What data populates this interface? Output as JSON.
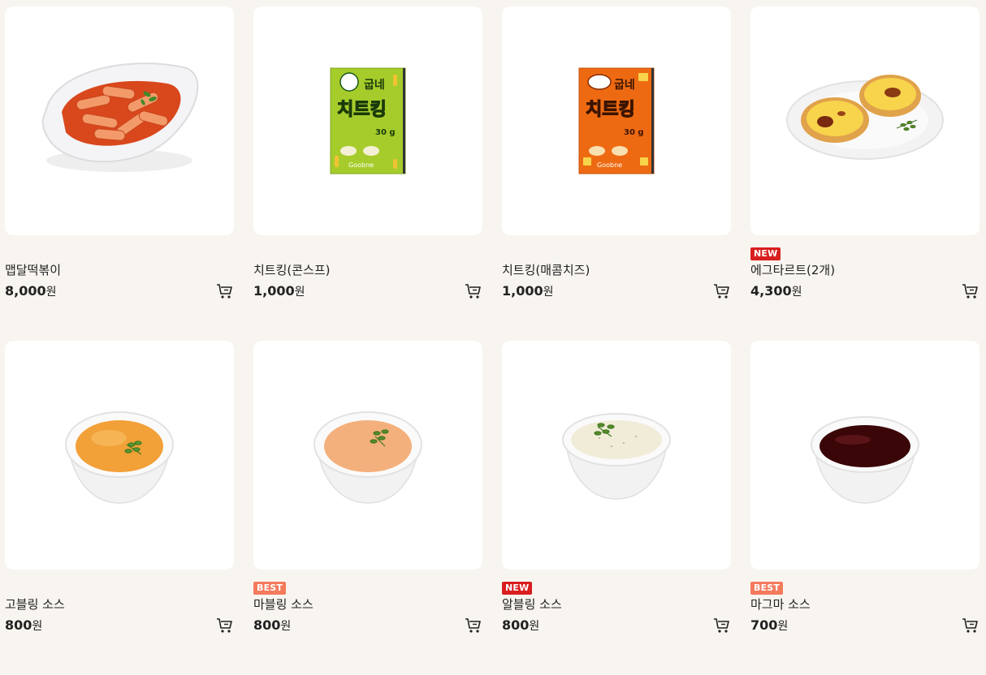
{
  "products": [
    {
      "name": "맵달떡볶이",
      "price": "8,000",
      "currency": "원",
      "badge": "",
      "image": "tteokbokki-image"
    },
    {
      "name": "치트킹(콘스프)",
      "price": "1,000",
      "currency": "원",
      "badge": "",
      "image": "cheatking-cornsoup-image",
      "pack_text": {
        "brand": "굽네",
        "title": "치트킹",
        "weight": "30 g",
        "logo": "Goobne"
      }
    },
    {
      "name": "치트킹(매콤치즈)",
      "price": "1,000",
      "currency": "원",
      "badge": "",
      "image": "cheatking-spicycheese-image",
      "pack_text": {
        "brand": "굽네",
        "title": "치트킹",
        "weight": "30 g",
        "logo": "Goobne"
      }
    },
    {
      "name": "에그타르트(2개)",
      "price": "4,300",
      "currency": "원",
      "badge": "NEW",
      "image": "egg-tart-image"
    },
    {
      "name": "고블링 소스",
      "price": "800",
      "currency": "원",
      "badge": "",
      "image": "gobling-sauce-image"
    },
    {
      "name": "마블링 소스",
      "price": "800",
      "currency": "원",
      "badge": "BEST",
      "image": "marbling-sauce-image"
    },
    {
      "name": "알블링 소스",
      "price": "800",
      "currency": "원",
      "badge": "NEW",
      "image": "albling-sauce-image"
    },
    {
      "name": "마그마 소스",
      "price": "700",
      "currency": "원",
      "badge": "BEST",
      "image": "magma-sauce-image"
    }
  ],
  "colors": {
    "background": "#f8f4ef",
    "badge_new": "#d81e1e",
    "badge_best": "#f47a5c"
  },
  "icons": {
    "cart": "cart-icon"
  }
}
